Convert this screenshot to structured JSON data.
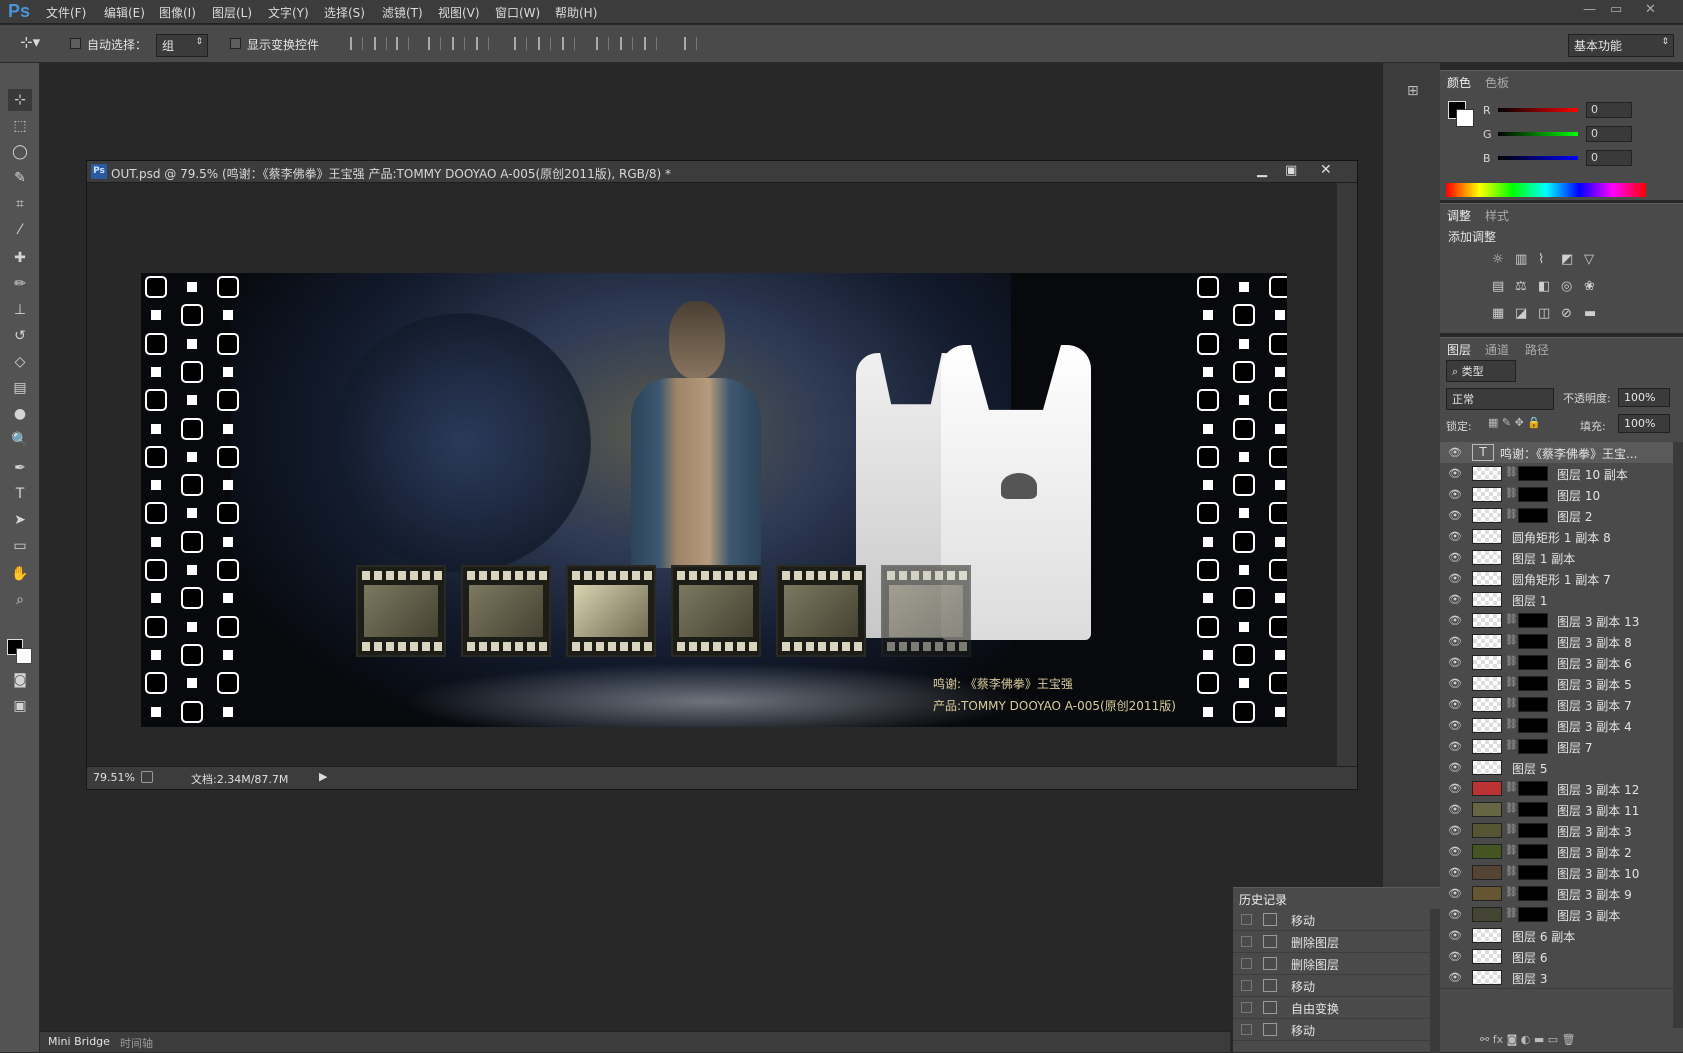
{
  "app": {
    "logo": "Ps"
  },
  "menu": [
    "文件(F)",
    "编辑(E)",
    "图像(I)",
    "图层(L)",
    "文字(Y)",
    "选择(S)",
    "滤镜(T)",
    "视图(V)",
    "窗口(W)",
    "帮助(H)"
  ],
  "window_controls": [
    "—",
    "▭",
    "✕"
  ],
  "options": {
    "auto_select_label": "自动选择：",
    "auto_select_value": "组",
    "show_transform_label": "显示变换控件",
    "workspace": "基本功能"
  },
  "document": {
    "title": "OUT.psd @ 79.5% (鸣谢：《蔡李佛拳》王宝强 产品:TOMMY DOOYAO A-005(原创2011版), RGB/8) *",
    "zoom": "79.51%",
    "doc_info": "文档:2.34M/87.7M",
    "art_text_line1": "鸣谢: 《蔡李佛拳》王宝强",
    "art_text_line2": "产品:TOMMY DOOYAO A-005(原创2011版)"
  },
  "color_panel": {
    "tabs": [
      "颜色",
      "色板"
    ],
    "r_label": "R",
    "g_label": "G",
    "b_label": "B",
    "r": "0",
    "g": "0",
    "b": "0"
  },
  "adjust_panel": {
    "tabs": [
      "调整",
      "样式"
    ],
    "title": "添加调整"
  },
  "layers_panel": {
    "tabs": [
      "图层",
      "通道",
      "路径"
    ],
    "filter": "类型",
    "blend_mode": "正常",
    "opacity_label": "不透明度:",
    "opacity": "100%",
    "lock_label": "锁定:",
    "fill_label": "填充:",
    "fill": "100%",
    "layers": [
      {
        "name": "鸣谢：《蔡李佛拳》王宝...",
        "kind": "text"
      },
      {
        "name": "图层 10 副本",
        "kind": "mask"
      },
      {
        "name": "图层 10",
        "kind": "mask"
      },
      {
        "name": "图层 2",
        "kind": "mask"
      },
      {
        "name": "圆角矩形 1 副本 8",
        "kind": "plain"
      },
      {
        "name": "图层 1 副本",
        "kind": "plain"
      },
      {
        "name": "圆角矩形 1 副本 7",
        "kind": "plain"
      },
      {
        "name": "图层 1",
        "kind": "plain"
      },
      {
        "name": "图层 3 副本 13",
        "kind": "mask"
      },
      {
        "name": "图层 3 副本 8",
        "kind": "mask"
      },
      {
        "name": "图层 3 副本 6",
        "kind": "mask"
      },
      {
        "name": "图层 3 副本 5",
        "kind": "mask"
      },
      {
        "name": "图层 3 副本 7",
        "kind": "mask"
      },
      {
        "name": "图层 3 副本 4",
        "kind": "mask"
      },
      {
        "name": "图层 7",
        "kind": "mask"
      },
      {
        "name": "图层 5",
        "kind": "plain"
      },
      {
        "name": "图层 3 副本 12",
        "kind": "mask"
      },
      {
        "name": "图层 3 副本 11",
        "kind": "mask"
      },
      {
        "name": "图层 3 副本 3",
        "kind": "mask"
      },
      {
        "name": "图层 3 副本 2",
        "kind": "mask"
      },
      {
        "name": "图层 3 副本 10",
        "kind": "mask"
      },
      {
        "name": "图层 3 副本 9",
        "kind": "mask"
      },
      {
        "name": "图层 3 副本",
        "kind": "mask"
      },
      {
        "name": "图层 6 副本",
        "kind": "plain"
      },
      {
        "name": "图层 6",
        "kind": "plain"
      },
      {
        "name": "图层 3",
        "kind": "plain"
      }
    ]
  },
  "history_panel": {
    "title": "历史记录",
    "items": [
      "移动",
      "删除图层",
      "删除图层",
      "移动",
      "自由变换",
      "移动"
    ]
  },
  "bottom_tabs": [
    "Mini Bridge",
    "时间轴"
  ]
}
